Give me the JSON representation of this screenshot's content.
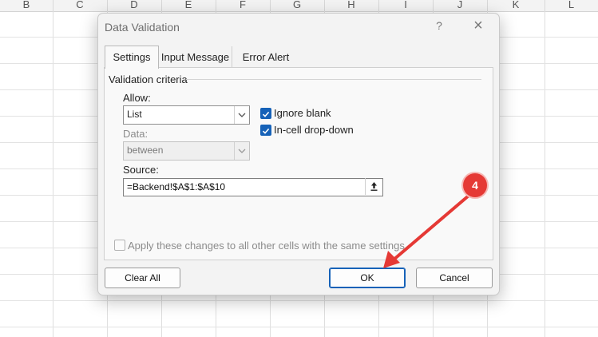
{
  "spreadsheet": {
    "columns": [
      "B",
      "C",
      "D",
      "E",
      "F",
      "G",
      "H",
      "I",
      "J",
      "K",
      "L"
    ]
  },
  "dialog": {
    "title": "Data Validation",
    "help_glyph": "?",
    "close_glyph": "×",
    "tabs": [
      {
        "label": "Settings",
        "active": true
      },
      {
        "label": "Input Message",
        "active": false
      },
      {
        "label": "Error Alert",
        "active": false
      }
    ],
    "group_label": "Validation criteria",
    "allow": {
      "label": "Allow:",
      "value": "List"
    },
    "data": {
      "label": "Data:",
      "value": "between"
    },
    "ignore_blank": {
      "label": "Ignore blank",
      "checked": true
    },
    "in_cell_dropdown": {
      "label": "In-cell drop-down",
      "checked": true
    },
    "source": {
      "label": "Source:",
      "value": "=Backend!$A$1:$A$10"
    },
    "apply_all": {
      "label": "Apply these changes to all other cells with the same settings",
      "checked": false
    },
    "buttons": {
      "clear_all": "Clear All",
      "ok": "OK",
      "cancel": "Cancel"
    }
  },
  "annotation": {
    "step_number": "4",
    "color": "#e53935"
  },
  "colors": {
    "accent": "#1662b8",
    "dialog_bg": "#f3f3f3"
  }
}
